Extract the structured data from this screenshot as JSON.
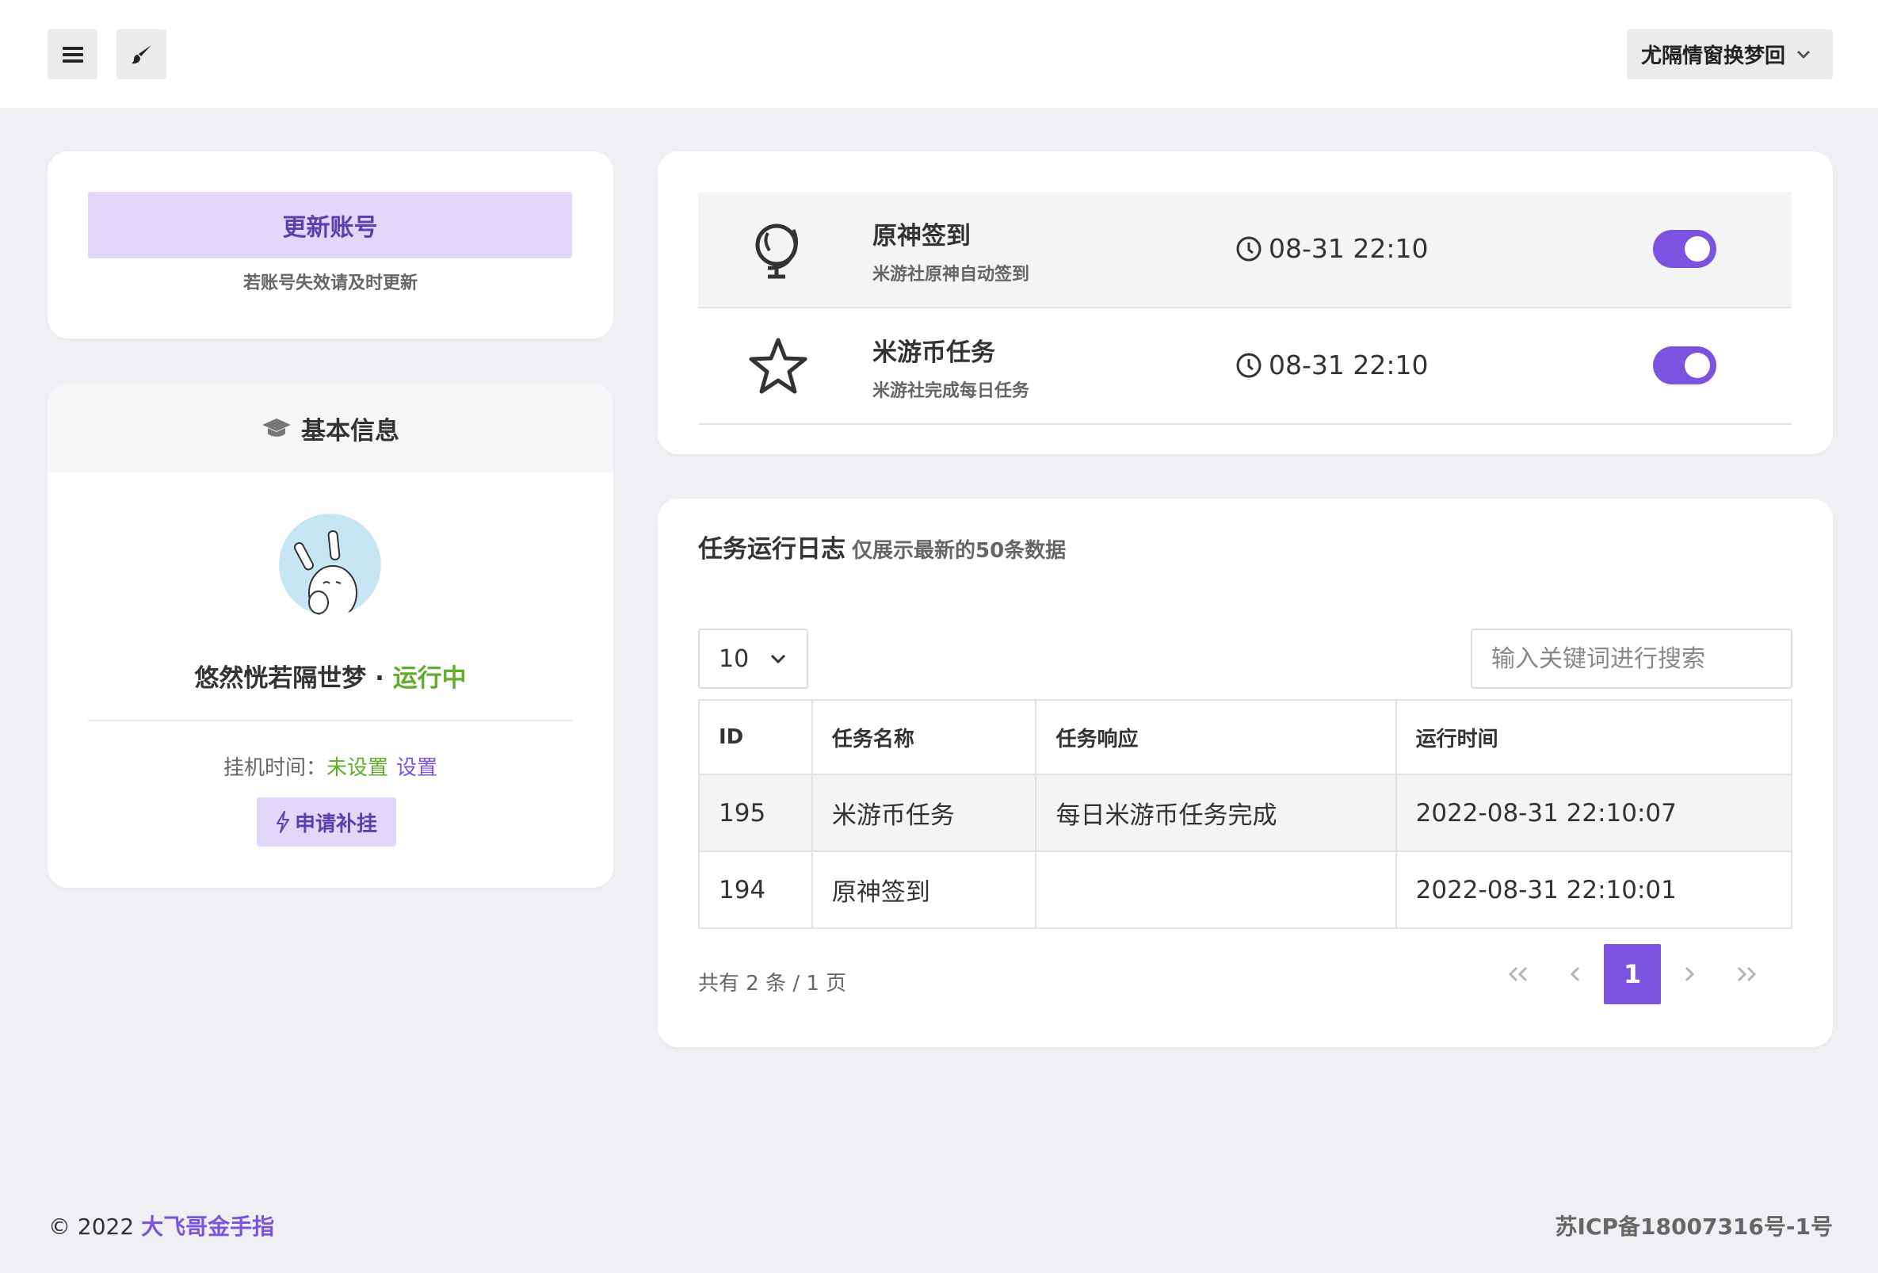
{
  "header": {
    "username": "尤隔情窗换梦回"
  },
  "account": {
    "update_button": "更新账号",
    "update_hint": "若账号失效请及时更新"
  },
  "basic_info": {
    "title": "基本信息",
    "name": "悠然恍若隔世梦",
    "separator": " · ",
    "status": "运行中",
    "hang_label": "挂机时间：",
    "hang_value": "未设置",
    "hang_set_link": "设置",
    "apply_button": "申请补挂"
  },
  "tasks": [
    {
      "icon": "globe-icon",
      "title": "原神签到",
      "subtitle": "米游社原神自动签到",
      "time": "08-31 22:10",
      "enabled": true
    },
    {
      "icon": "star-icon",
      "title": "米游币任务",
      "subtitle": "米游社完成每日任务",
      "time": "08-31 22:10",
      "enabled": true
    }
  ],
  "log": {
    "title": "任务运行日志",
    "subtitle": "仅展示最新的50条数据",
    "page_size": "10",
    "search_placeholder": "输入关键词进行搜索",
    "columns": [
      "ID",
      "任务名称",
      "任务响应",
      "运行时间"
    ],
    "rows": [
      [
        "195",
        "米游币任务",
        "每日米游币任务完成",
        "2022-08-31 22:10:07"
      ],
      [
        "194",
        "原神签到",
        "",
        "2022-08-31 22:10:01"
      ]
    ],
    "total": "共有 2 条 / 1 页",
    "current_page": "1"
  },
  "footer": {
    "copyright": "© 2022 ",
    "brand": "大飞哥金手指",
    "icp": "苏ICP备18007316号-1号"
  },
  "colors": {
    "accent": "#7c52e0",
    "accent_light": "#e1d7f8",
    "success": "#5fae2c",
    "background": "#f0f0f4"
  }
}
